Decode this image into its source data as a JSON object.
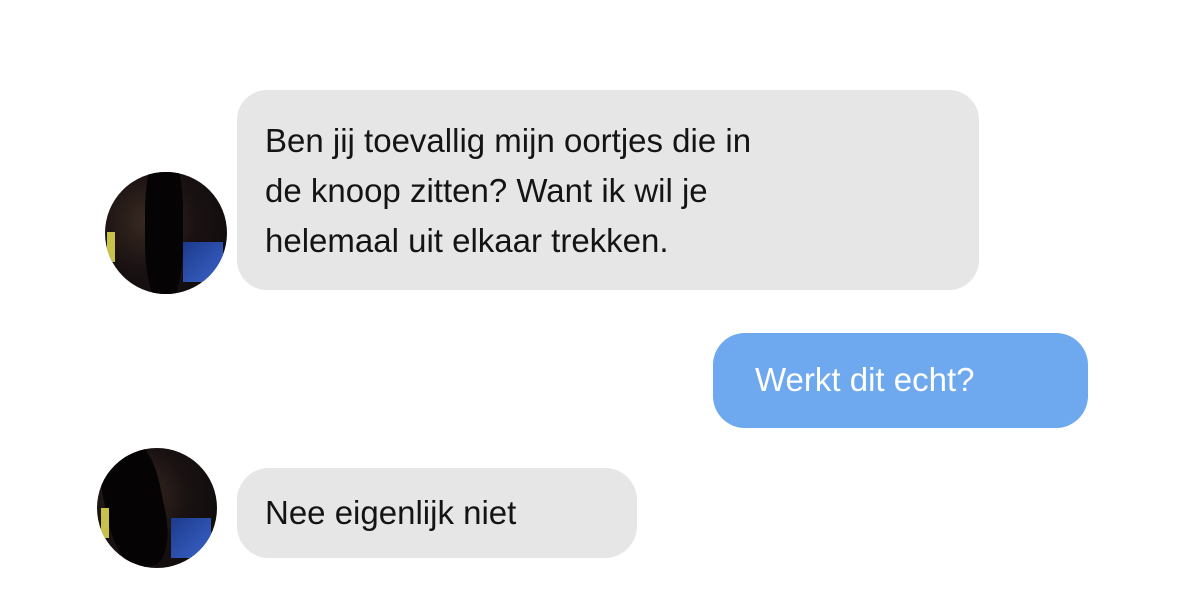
{
  "messages": [
    {
      "direction": "received",
      "lines": [
        "Ben jij toevallig mijn oortjes die in",
        "de knoop zitten? Want ik wil je",
        "helemaal uit elkaar trekken."
      ]
    },
    {
      "direction": "sent",
      "lines": [
        "Werkt dit echt?"
      ]
    },
    {
      "direction": "received",
      "lines": [
        "Nee eigenlijk niet"
      ]
    }
  ],
  "colors": {
    "received_bubble": "#e6e6e6",
    "sent_bubble": "#6ea8ee",
    "background": "#ffffff"
  },
  "icons": [
    "contact-avatar-icon"
  ]
}
